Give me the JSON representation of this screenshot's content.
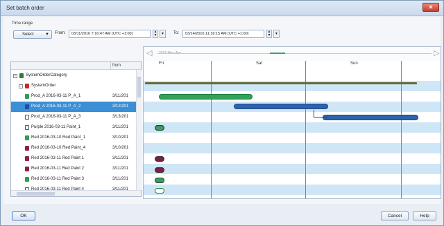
{
  "window": {
    "title": "Set batch order",
    "close_glyph": "✕"
  },
  "toolbar": {
    "time_range_label": "Time range",
    "select_label": "Select",
    "from_label": "From:",
    "from_value": "03/11/2016 7:16:47 AM (UTC +1:00)",
    "to_label": "To:",
    "to_value": "03/14/2016 11:16:15 AM (UTC +1:00)"
  },
  "tree": {
    "column_from": "from",
    "rows": [
      {
        "label": "SystemOrderCategory",
        "from": "",
        "icon": "category-icon",
        "color": "#2e7d32"
      },
      {
        "label": "SystemOrder",
        "from": "",
        "icon": "system-order-icon",
        "color": "#c62828"
      },
      {
        "label": "Prod_A  2016-03-11 P_A_1",
        "from": "3/11/201",
        "icon": "order-icon",
        "color": "#2e9e4f"
      },
      {
        "label": "Prod_A  2016-03-11 P_A_2",
        "from": "3/12/201",
        "icon": "order-icon",
        "color": "#1f4f9e"
      },
      {
        "label": "Prod_A  2016-03-11 P_A_3",
        "from": "3/13/201",
        "icon": "order-icon",
        "color": "#ffffff"
      },
      {
        "label": "Purple  2016-03-11 Paint_1",
        "from": "3/11/201",
        "icon": "order-icon",
        "color": "#ffffff"
      },
      {
        "label": "Red  2016-03-10 Red Paint_1",
        "from": "3/10/201",
        "icon": "order-icon",
        "color": "#2e9e4f"
      },
      {
        "label": "Red  2016-03-10 Red Paint_4",
        "from": "3/10/201",
        "icon": "order-icon",
        "color": "#8e1f4a"
      },
      {
        "label": "Red  2016-03-11 Red Paint 1",
        "from": "3/11/201",
        "icon": "order-icon",
        "color": "#8e1f4a"
      },
      {
        "label": "Red  2016-03-11 Red Paint 2",
        "from": "3/11/201",
        "icon": "order-icon",
        "color": "#8e1f4a"
      },
      {
        "label": "Red  2016-03-11 Red Paint 3",
        "from": "3/11/201",
        "icon": "order-icon",
        "color": "#2e9e4f"
      },
      {
        "label": "Red  2016-03-11 Red Paint 4",
        "from": "3/11/201",
        "icon": "order-icon",
        "color": "#ffffff"
      }
    ]
  },
  "gantt": {
    "range_label": "2016 Mar–Apr",
    "days": [
      "Fri",
      "Sat",
      "Sun"
    ]
  },
  "buttons": {
    "ok": "OK",
    "cancel": "Cancel",
    "help": "Help"
  },
  "colors": {
    "selected_row": "#3b8fd6",
    "band_blue": "#cfe6f6",
    "bar_green": "#31a257",
    "bar_blue": "#2d62ad"
  }
}
